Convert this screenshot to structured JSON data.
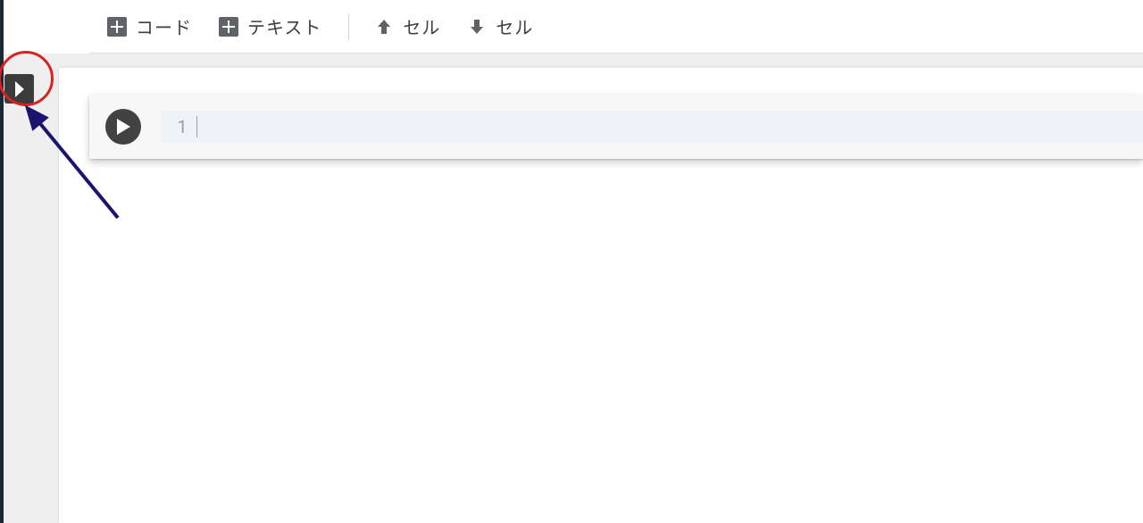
{
  "toolbar": {
    "code_label": "コード",
    "text_label": "テキスト",
    "cell_up_label": "セル",
    "cell_down_label": "セル"
  },
  "cell": {
    "line_number": "1",
    "content": ""
  }
}
